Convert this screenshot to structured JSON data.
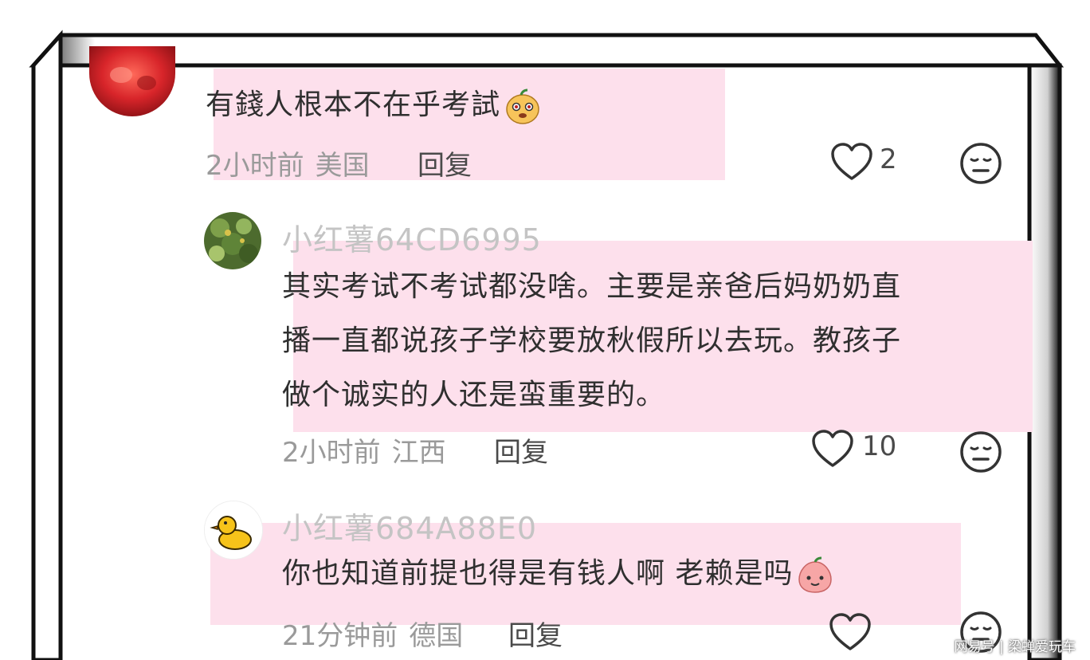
{
  "comments": [
    {
      "text": "有錢人根本不在乎考試",
      "time": "2小时前",
      "location": "美国",
      "reply_label": "回复",
      "like_count": "2",
      "emoji": "fruit-face-emoji"
    },
    {
      "username": "小红薯64CD6995",
      "lines": [
        "其实考试不考试都没啥。主要是亲爸后妈奶奶直",
        "播一直都说孩子学校要放秋假所以去玩。教孩子",
        "做个诚实的人还是蛮重要的。"
      ],
      "time": "2小时前",
      "location": "江西",
      "reply_label": "回复",
      "like_count": "10"
    },
    {
      "username": "小红薯684A88E0",
      "text": "你也知道前提也得是有钱人啊 老赖是吗",
      "time": "21分钟前",
      "location": "德国",
      "reply_label": "回复",
      "like_count": "",
      "emoji": "peach-face-emoji"
    }
  ],
  "watermark": "网易号 | 梁蝉爱玩车",
  "colors": {
    "highlight": "#fde0ec",
    "username": "#c4c4c4",
    "meta": "#9a9a9a",
    "text": "#2f2f2f"
  }
}
